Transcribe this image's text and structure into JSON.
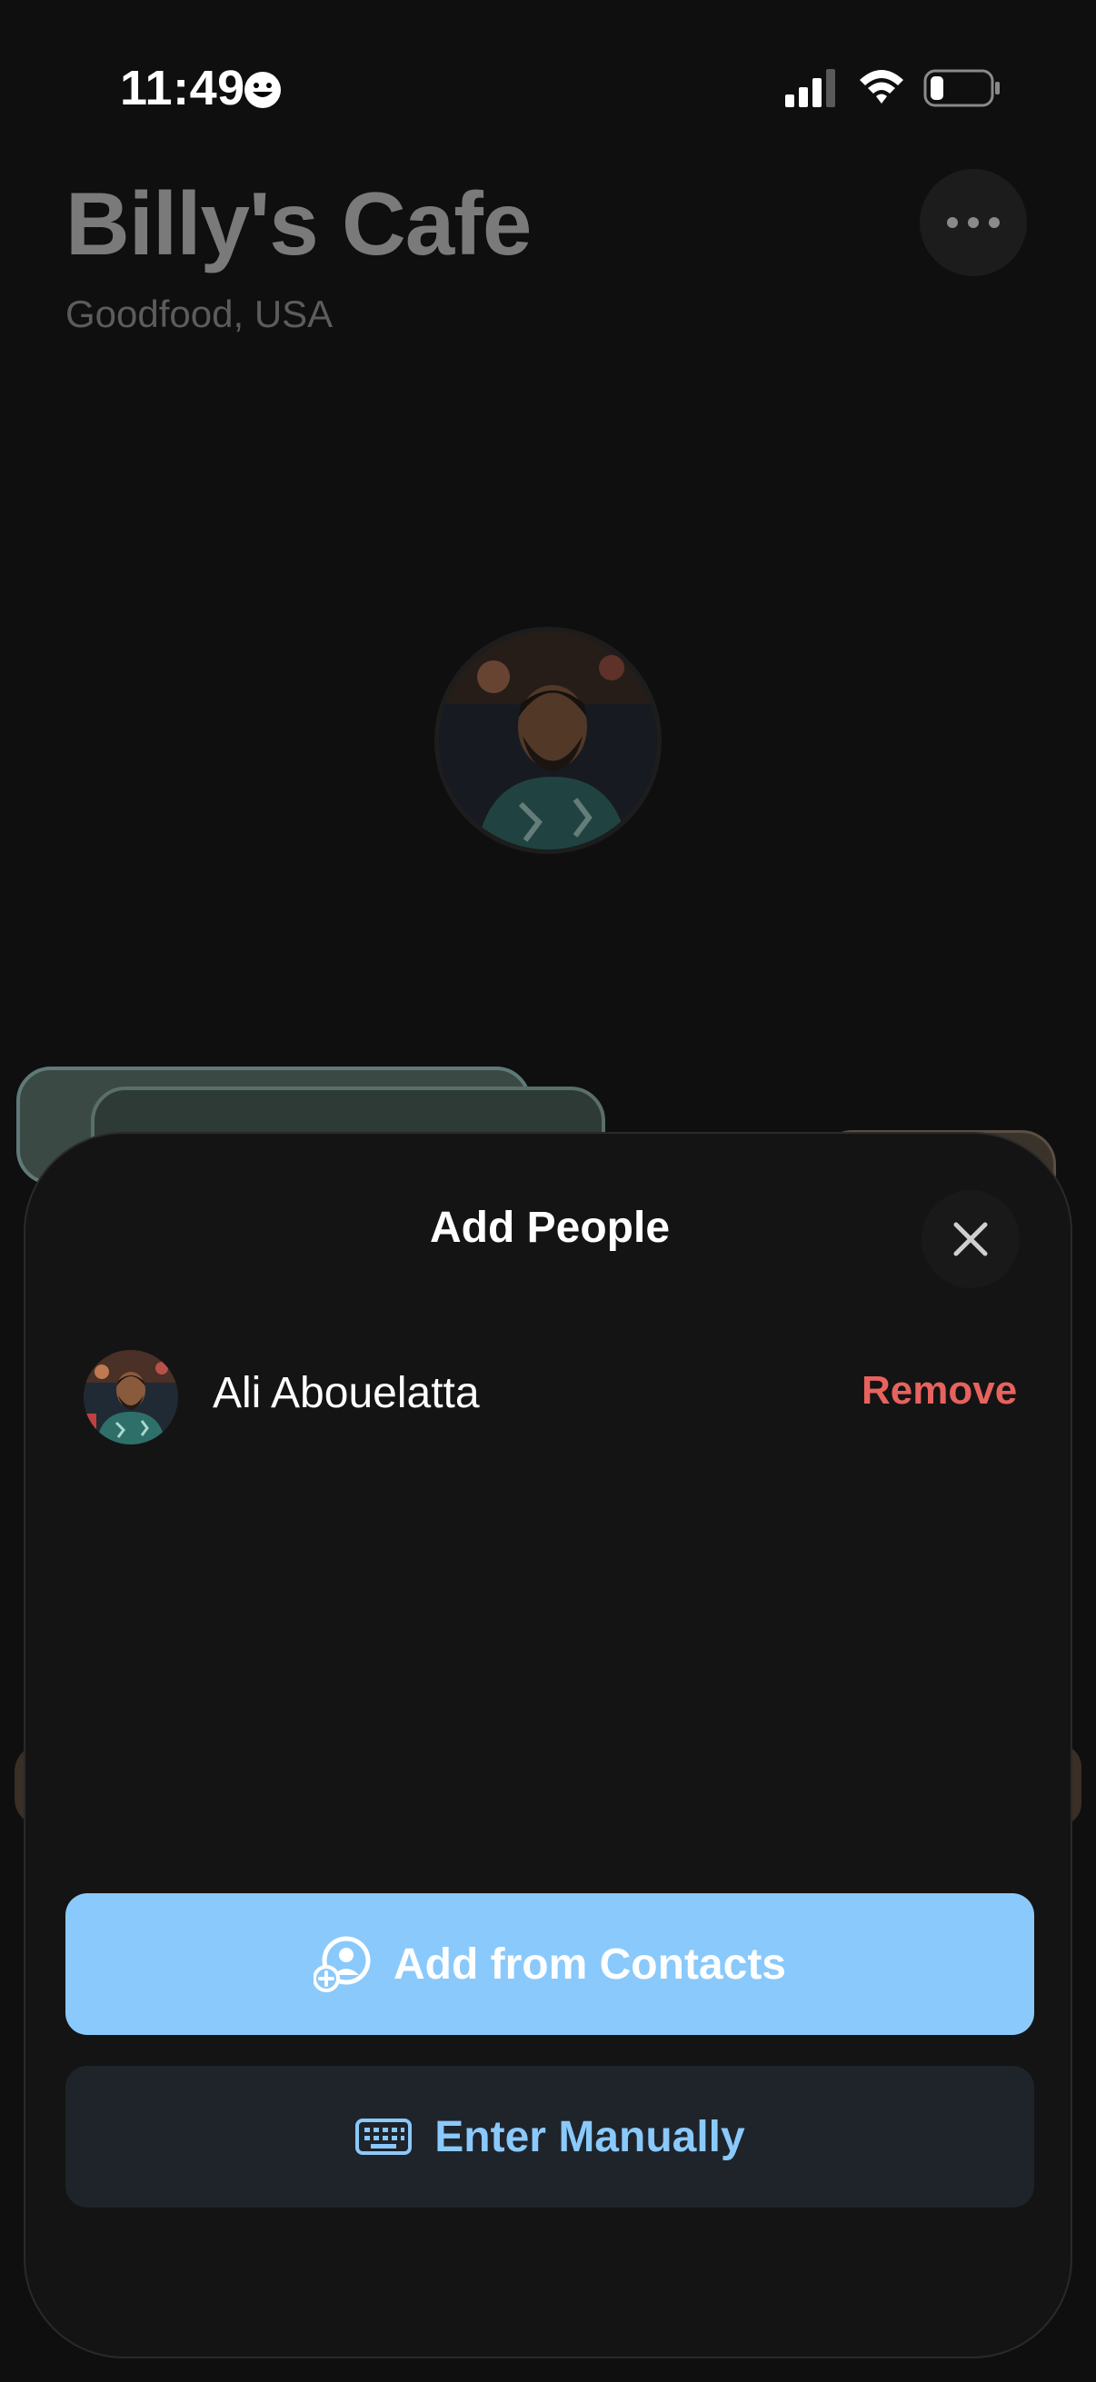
{
  "status_bar": {
    "time": "11:49",
    "icons": [
      "smiley-icon",
      "cellular-signal-icon",
      "wifi-icon",
      "battery-icon"
    ]
  },
  "background": {
    "cafe_name": "Billy's Cafe",
    "location": "Goodfood, USA",
    "more_icon": "ellipsis-icon"
  },
  "sheet": {
    "title": "Add People",
    "close_icon": "close-icon",
    "people": [
      {
        "name": "Ali Abouelatta",
        "action": "Remove"
      }
    ],
    "buttons": {
      "contacts": {
        "label": "Add from Contacts",
        "icon": "add-contact-icon"
      },
      "manual": {
        "label": "Enter Manually",
        "icon": "keyboard-icon"
      }
    }
  },
  "colors": {
    "accent": "#8ac9fb",
    "danger": "#e8625e",
    "sheet_bg": "#141414",
    "page_bg": "#0f0f0f"
  }
}
